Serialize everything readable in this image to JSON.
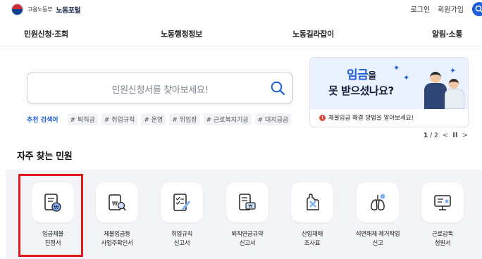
{
  "header": {
    "logo_sub": "고용노동부",
    "logo_main": "노동포털",
    "login": "로그인",
    "signup": "회원가입",
    "search_icon": "search-icon"
  },
  "nav": {
    "items": [
      "민원신청·조회",
      "노동행정정보",
      "노동길라잡이",
      "알림·소통"
    ]
  },
  "search": {
    "placeholder": "민원신청서를 찾아보세요!",
    "icon": "search-icon"
  },
  "recommended": {
    "label": "추천 검색어",
    "chips": [
      "# 퇴직금",
      "# 취업규칙",
      "# 운영",
      "# 위임장",
      "# 근로복지기금",
      "# 대지급금"
    ]
  },
  "banner": {
    "line1_emph": "임금",
    "line1_rest": "을",
    "line2": "못 받으셨나요?",
    "caption": "체불임금 해결 방법을 알아보세요!",
    "accent": "#1d5ed8"
  },
  "pager": {
    "current": "1",
    "total": "2",
    "prev": "<",
    "pause": "II",
    "next": ">"
  },
  "section": {
    "title": "자주 찾는 민원"
  },
  "services": [
    {
      "line1": "임금체불",
      "line2": "진정서",
      "icon": "wage-claim-icon"
    },
    {
      "line1": "체불임금등",
      "line2": "사업주확인서",
      "icon": "employer-confirmation-icon"
    },
    {
      "line1": "취업규칙",
      "line2": "신고서",
      "icon": "work-rules-icon"
    },
    {
      "line1": "퇴직연금규약",
      "line2": "신고서",
      "icon": "pension-icon"
    },
    {
      "line1": "산업재해",
      "line2": "조사표",
      "icon": "industrial-accident-icon"
    },
    {
      "line1": "석면해체·제거작업",
      "line2": "신고",
      "icon": "asbestos-lungs-icon"
    },
    {
      "line1": "근로감독",
      "line2": "청원서",
      "icon": "labor-inspection-monitor-icon"
    }
  ],
  "colors": {
    "brand_blue": "#1d5ed8",
    "highlight_red": "#e01b1b",
    "services_bg": "#f2f4f7"
  }
}
